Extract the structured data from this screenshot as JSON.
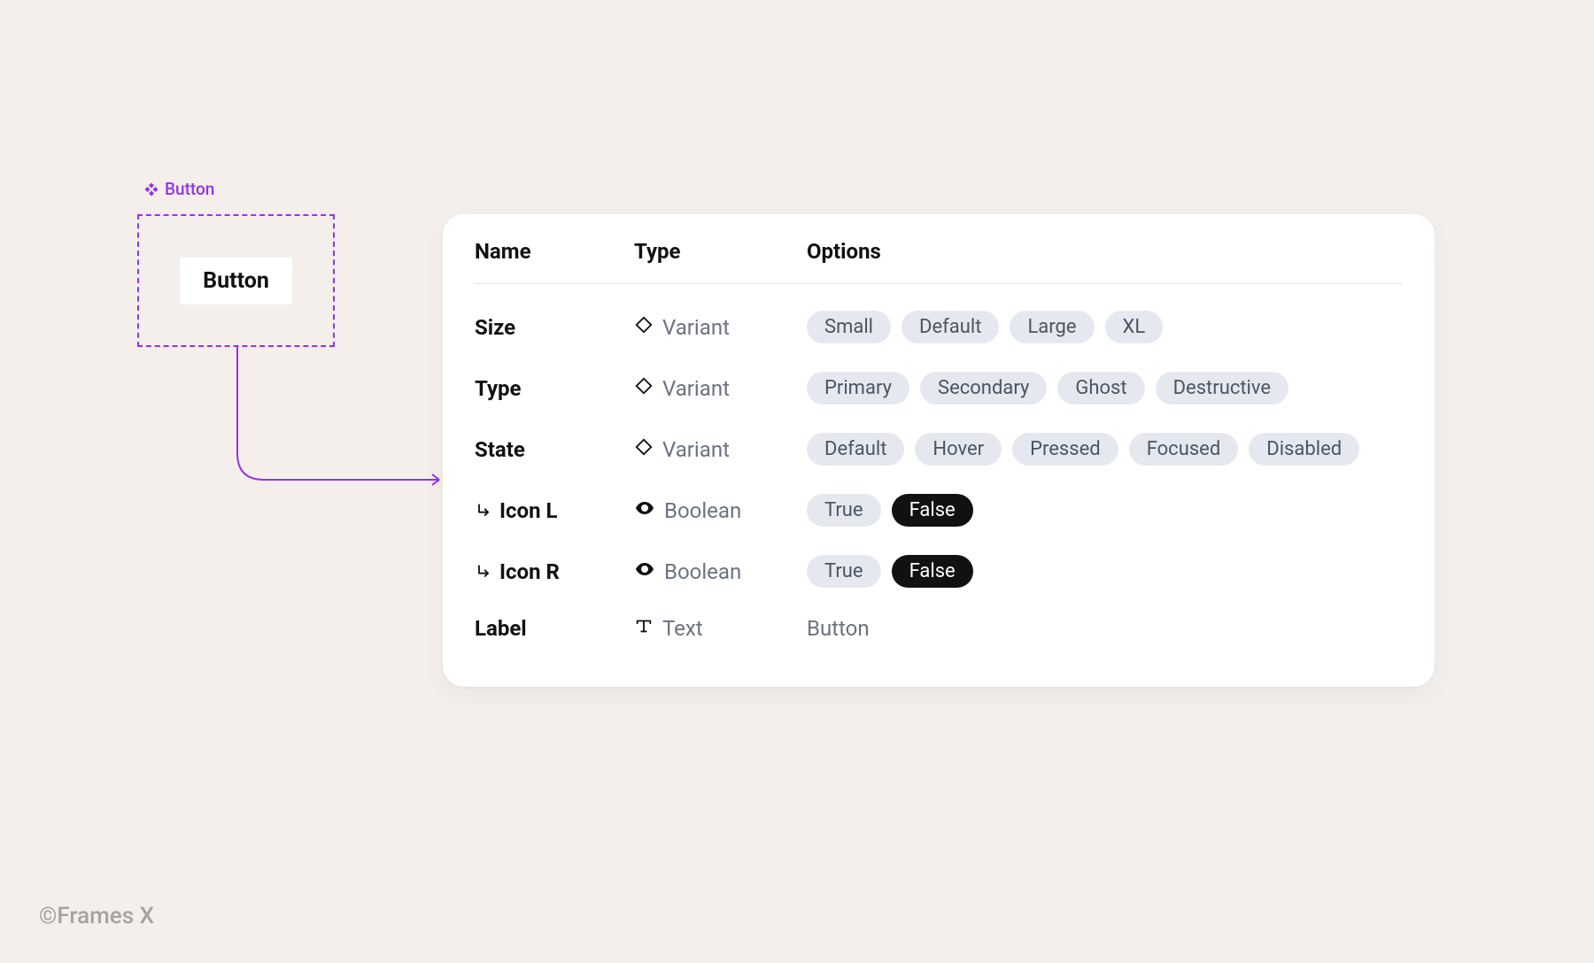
{
  "component": {
    "label": "Button",
    "preview_text": "Button"
  },
  "panel": {
    "headers": {
      "name": "Name",
      "type": "Type",
      "options": "Options"
    },
    "type_labels": {
      "variant": "Variant",
      "boolean": "Boolean",
      "text": "Text"
    },
    "rows": {
      "size": {
        "name": "Size",
        "options": [
          "Small",
          "Default",
          "Large",
          "XL"
        ]
      },
      "type": {
        "name": "Type",
        "options": [
          "Primary",
          "Secondary",
          "Ghost",
          "Destructive"
        ]
      },
      "state": {
        "name": "State",
        "options": [
          "Default",
          "Hover",
          "Pressed",
          "Focused",
          "Disabled"
        ]
      },
      "icon_l": {
        "name": "Icon L",
        "true": "True",
        "false": "False",
        "active": "false"
      },
      "icon_r": {
        "name": "Icon R",
        "true": "True",
        "false": "False",
        "active": "false"
      },
      "label": {
        "name": "Label",
        "value": "Button"
      }
    }
  },
  "footer": "©Frames X",
  "colors": {
    "accent": "#9333ea",
    "pill_bg": "#e5e9ef",
    "pill_active_bg": "#111111"
  }
}
